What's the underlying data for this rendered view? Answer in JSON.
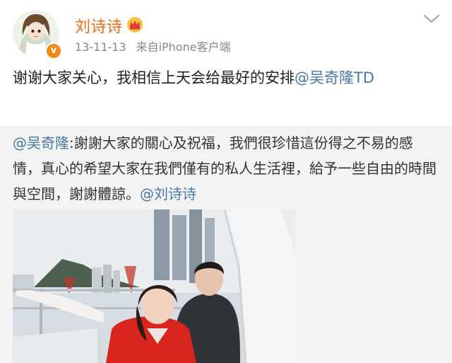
{
  "post": {
    "username": "刘诗诗",
    "date": "13-11-13",
    "source": "来自iPhone客户端",
    "text_main": "谢谢大家关心，我相信上天会给最好的安排",
    "mention": "@吴奇隆TD"
  },
  "repost": {
    "author_mention": "@吴奇隆",
    "text": ":謝謝大家的關心及祝福，我們很珍惜這份得之不易的感情，真心的希望大家在我們僅有的私人生活裡，給予一些自由的時間與空間，謝謝體諒。",
    "trailing_mention": "@刘诗诗"
  },
  "icons": {
    "crown": "crown-icon",
    "verified": "verified-badge-icon",
    "more": "chevron-down-icon"
  },
  "colors": {
    "username": "#f26a11",
    "mention": "#4a78a8",
    "repost_bg": "#f3f3f3",
    "meta": "#888888"
  }
}
